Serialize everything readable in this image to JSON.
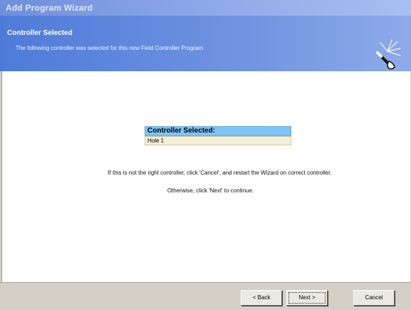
{
  "window": {
    "title": "Add Program Wizard"
  },
  "header": {
    "title": "Controller Selected",
    "subtitle": "The following controller was selected for this new Field Controller Program",
    "icon": "magic-wand-icon"
  },
  "main": {
    "controller_label": "Controller Selected:",
    "controller_value": "Hole 1",
    "message_line1": "If this is not the right controller, click 'Cancel', and restart the Wizard on correct controller.",
    "message_line2": "Otherwise, click 'Next' to continue."
  },
  "footer": {
    "back_label": "< Back",
    "next_label": "Next >",
    "cancel_label": "Cancel"
  },
  "colors": {
    "header_blue": "#4e7bd9",
    "controller_header_bg": "#7ec4f5",
    "controller_value_bg": "#f5efd8"
  }
}
